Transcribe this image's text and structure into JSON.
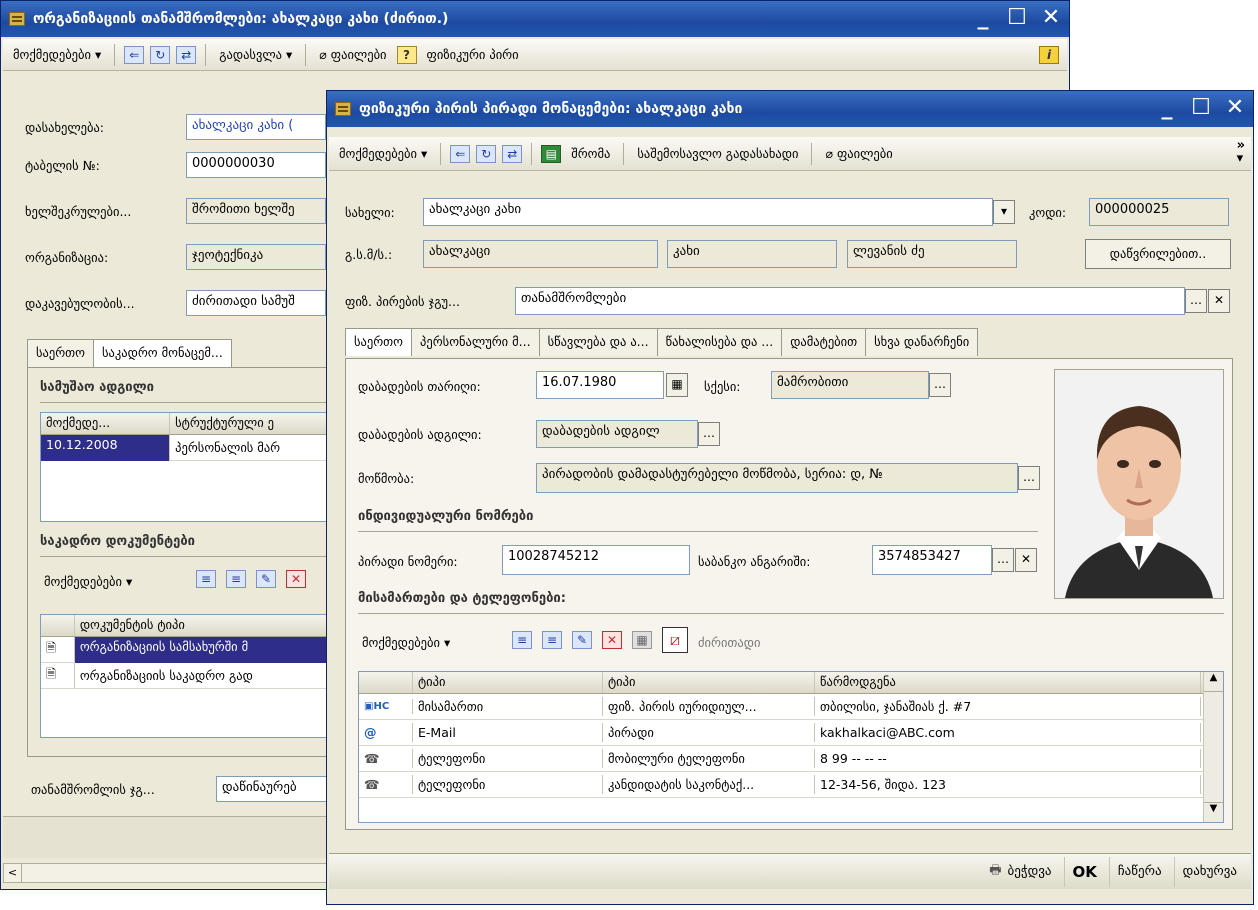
{
  "back": {
    "title": "ორგანიზაციის თანამშრომლები: ახალკაცი კახი (ძირით.)",
    "toolbar": {
      "actions": "მოქმედებები ▾",
      "goto": "გადასვლა ▾",
      "files": "ფაილები",
      "help": "?",
      "person": "ფიზიკური პირი"
    },
    "labels": {
      "name": "დასახელება:",
      "tabnum": "ტაბელის №:",
      "contract": "ხელშეკრულები...",
      "org": "ორგანიზაცია:",
      "employment": "დაკავებულობის..."
    },
    "values": {
      "name": "ახალკაცი კახი (",
      "tabnum": "0000000030",
      "contract": "შრომითი ხელშე",
      "org": "ჯეოტექნიკა",
      "employment": "ძირითადი სამუშ"
    },
    "tabs": [
      "საერთო",
      "საკადრო მონაცემ..."
    ],
    "section_work": "სამუშაო ადგილი",
    "work_grid": {
      "headers": [
        "მოქმედე...",
        "სტრუქტურული ე"
      ],
      "rows": [
        [
          "10.12.2008",
          "პერსონალის მარ"
        ]
      ]
    },
    "section_docs": "საკადრო დოკუმენტები",
    "docs_actions": "მოქმედებები ▾",
    "docs_grid": {
      "header": "დოკუმენტის ტიპი",
      "rows": [
        "ორგანიზაციის სამსახურში მ",
        "ორგანიზაციის საკადრო გად"
      ]
    },
    "employee_group_label": "თანამშრომლის ჯგ...",
    "employee_group_value": "დაწინაურებ"
  },
  "front": {
    "title": "ფიზიკური პირის პირადი მონაცემები: ახალკაცი კახი",
    "toolbar": {
      "actions": "მოქმედებები ▾",
      "work": "შრომა",
      "tax": "საშემოსავლო გადასახადი",
      "files": "ფაილები"
    },
    "labels": {
      "name": "სახელი:",
      "code": "კოდი:",
      "fio": "გ.ს.მ/ს.:",
      "group": "ფიზ. პირების ჯგუ..."
    },
    "values": {
      "name": "ახალკაცი კახი",
      "code": "000000025",
      "surname": "ახალკაცი",
      "first": "კახი",
      "patronymic": "ლევანის ძე",
      "group": "თანამშრომლები"
    },
    "detailed_button": "დაწვრილებით..",
    "tabs": [
      "საერთო",
      "პერსონალური მ...",
      "სწავლება და ა...",
      "წახალისება და ...",
      "დამატებით",
      "სხვა დანარჩენი"
    ],
    "general": {
      "birthdate_label": "დაბადების თარიღი:",
      "birthdate": "16.07.1980",
      "sex_label": "სქესი:",
      "sex": "მამრობითი",
      "birthplace_label": "დაბადების ადგილი:",
      "birthplace": "დაბადების ადგილ",
      "certificate_label": "მოწმობა:",
      "certificate": "პირადობის დამადასტურებელი მოწმობა, სერია: დ, №",
      "id_section": "ინდივიდუალური ნომრები",
      "personal_label": "პირადი ნომერი:",
      "personal": "10028745212",
      "bank_label": "საბანკო ანგარიში:",
      "bank": "3574853427",
      "contacts_section": "მისამართები და ტელეფონები:",
      "contacts_actions": "მოქმედებები ▾",
      "contacts_main": "ძირითადი",
      "grid_headers": [
        "ტიპი",
        "ტიპი",
        "წარმოდგენა"
      ],
      "rows": [
        {
          "icon": "address-icon",
          "type": "მისამართი",
          "kind": "ფიზ. პირის იურიდიულ...",
          "value": "თბილისი, ჯანაშიას ქ. #7"
        },
        {
          "icon": "email-icon",
          "type": "E-Mail",
          "kind": "პირადი",
          "value": "kakhalkaci@ABC.com"
        },
        {
          "icon": "phone-icon",
          "type": "ტელეფონი",
          "kind": "მობილური ტელეფონი",
          "value": "8 99 -- -- --"
        },
        {
          "icon": "phone-icon",
          "type": "ტელეფონი",
          "kind": "კანდიდატის საკონტაქ...",
          "value": "12-34-56, შიდა. 123"
        }
      ]
    },
    "bottom": {
      "print": "ბეჭდვა",
      "ok": "OK",
      "write": "ჩაწერა",
      "close": "დახურვა"
    }
  }
}
